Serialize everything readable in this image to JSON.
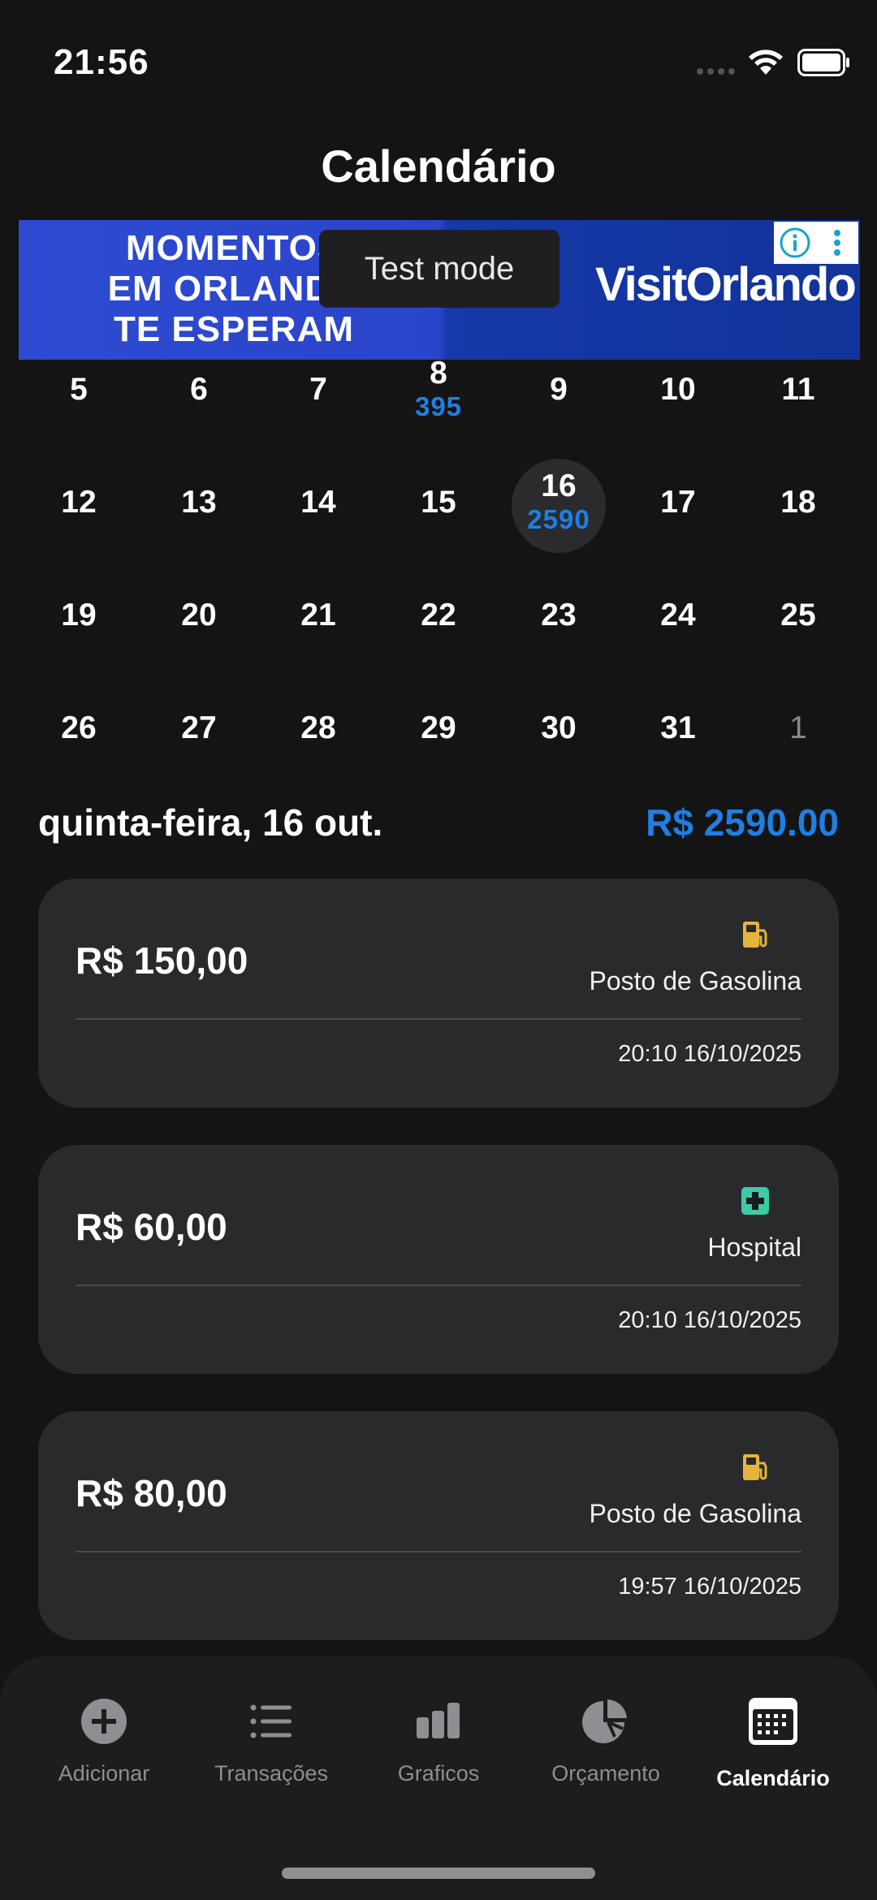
{
  "status_bar": {
    "time": "21:56"
  },
  "header": {
    "title": "Calendário"
  },
  "ad": {
    "left_lines": [
      "MOMENTOS",
      "EM ORLANDO",
      "TE ESPERAM"
    ],
    "right_text": "VisitOrlando",
    "test_mode_label": "Test mode"
  },
  "calendar": {
    "rows": [
      [
        {
          "day": "5"
        },
        {
          "day": "6"
        },
        {
          "day": "7"
        },
        {
          "day": "8",
          "amount": "395"
        },
        {
          "day": "9"
        },
        {
          "day": "10"
        },
        {
          "day": "11"
        }
      ],
      [
        {
          "day": "12"
        },
        {
          "day": "13"
        },
        {
          "day": "14"
        },
        {
          "day": "15"
        },
        {
          "day": "16",
          "amount": "2590",
          "selected": true
        },
        {
          "day": "17"
        },
        {
          "day": "18"
        }
      ],
      [
        {
          "day": "19"
        },
        {
          "day": "20"
        },
        {
          "day": "21"
        },
        {
          "day": "22"
        },
        {
          "day": "23"
        },
        {
          "day": "24"
        },
        {
          "day": "25"
        }
      ],
      [
        {
          "day": "26"
        },
        {
          "day": "27"
        },
        {
          "day": "28"
        },
        {
          "day": "29"
        },
        {
          "day": "30"
        },
        {
          "day": "31"
        },
        {
          "day": "1",
          "other_month": true
        }
      ]
    ]
  },
  "selected_day": {
    "label": "quinta-feira, 16 out.",
    "total": "R$ 2590.00"
  },
  "transactions": [
    {
      "amount": "R$ 150,00",
      "category": "Posto de Gasolina",
      "icon": "fuel-pump-icon",
      "icon_color": "#e4b43c",
      "datetime": "20:10 16/10/2025"
    },
    {
      "amount": "R$ 60,00",
      "category": "Hospital",
      "icon": "medical-cross-icon",
      "icon_color": "#3ec9a7",
      "datetime": "20:10 16/10/2025"
    },
    {
      "amount": "R$ 80,00",
      "category": "Posto de Gasolina",
      "icon": "fuel-pump-icon",
      "icon_color": "#e4b43c",
      "datetime": "19:57 16/10/2025"
    }
  ],
  "tab_bar": {
    "tabs": [
      {
        "label": "Adicionar",
        "icon": "plus-circle-icon"
      },
      {
        "label": "Transações",
        "icon": "list-icon"
      },
      {
        "label": "Graficos",
        "icon": "bar-chart-icon"
      },
      {
        "label": "Orçamento",
        "icon": "pie-chart-icon"
      },
      {
        "label": "Calendário",
        "icon": "calendar-icon",
        "active": true
      }
    ]
  },
  "colors": {
    "accent": "#1e7fe3",
    "background": "#141415",
    "card": "#2a2a2c"
  }
}
